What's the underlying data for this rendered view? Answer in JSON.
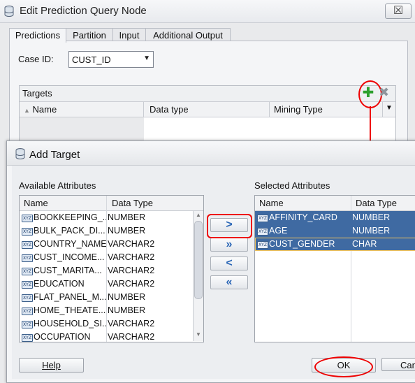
{
  "outer": {
    "title": "Edit Prediction Query Node",
    "close_glyph": "☒",
    "tabs": [
      "Predictions",
      "Partition",
      "Input",
      "Additional Output"
    ],
    "case_id_label": "Case ID:",
    "case_id_value": "CUST_ID",
    "targets_label": "Targets",
    "targets_columns": [
      "Name",
      "Data type",
      "Mining Type"
    ],
    "add_icon": "plus-icon",
    "remove_icon": "delete-icon"
  },
  "inner": {
    "title": "Add Target",
    "available_label": "Available Attributes",
    "selected_label": "Selected Attributes",
    "columns": [
      "Name",
      "Data Type"
    ],
    "type_badge": "XYZ",
    "available_rows": [
      {
        "name": "BOOKKEEPING_...",
        "type": "NUMBER"
      },
      {
        "name": "BULK_PACK_DI...",
        "type": "NUMBER"
      },
      {
        "name": "COUNTRY_NAME",
        "type": "VARCHAR2"
      },
      {
        "name": "CUST_INCOME...",
        "type": "VARCHAR2"
      },
      {
        "name": "CUST_MARITA...",
        "type": "VARCHAR2"
      },
      {
        "name": "EDUCATION",
        "type": "VARCHAR2"
      },
      {
        "name": "FLAT_PANEL_M...",
        "type": "NUMBER"
      },
      {
        "name": "HOME_THEATE...",
        "type": "NUMBER"
      },
      {
        "name": "HOUSEHOLD_SI...",
        "type": "VARCHAR2"
      },
      {
        "name": "OCCUPATION",
        "type": "VARCHAR2"
      }
    ],
    "selected_rows": [
      {
        "name": "AFFINITY_CARD",
        "type": "NUMBER"
      },
      {
        "name": "AGE",
        "type": "NUMBER"
      },
      {
        "name": "CUST_GENDER",
        "type": "CHAR"
      }
    ],
    "move_buttons": [
      ">",
      "»",
      "<",
      "«"
    ],
    "help_label": "Help",
    "ok_label": "OK",
    "cancel_label": "Can"
  },
  "colors": {
    "accent_red": "#e00000",
    "selection": "#3f6aa2",
    "add_green": "#2da02d"
  }
}
